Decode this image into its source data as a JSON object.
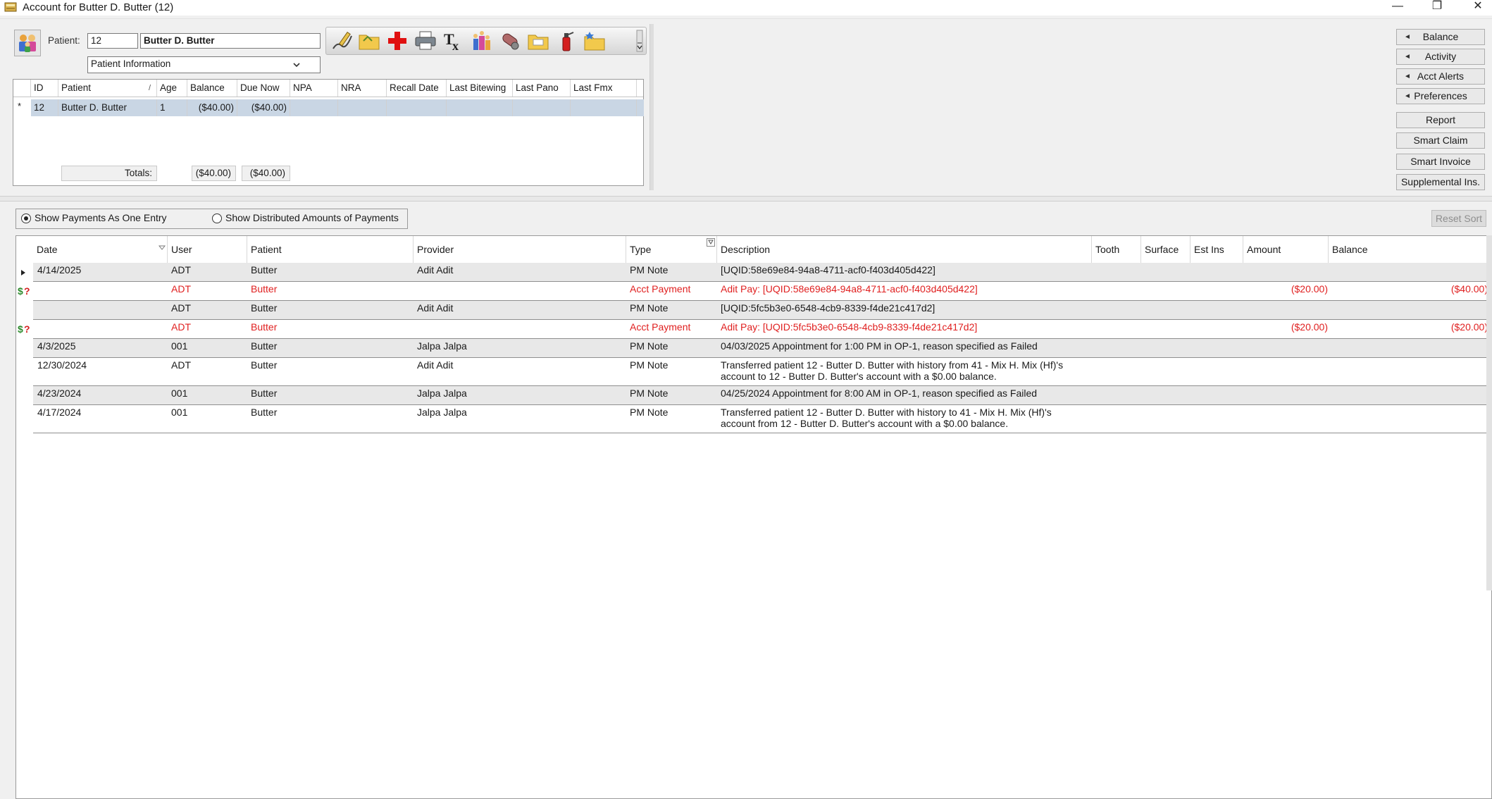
{
  "window": {
    "title": "Account for Butter D. Butter (12)",
    "minimize": "—",
    "restore": "❐",
    "close": "✕"
  },
  "patient_select": {
    "label": "Patient:",
    "id_value": "12",
    "name_value": "Butter D. Butter",
    "dropdown_value": "Patient Information"
  },
  "toolbar_icons": [
    "edit-note-icon",
    "folder-icon",
    "medical-cross-icon",
    "printer-icon",
    "prescription-icon",
    "family-icon",
    "pill-icon",
    "folder-open-icon",
    "spray-icon",
    "folder-star-icon"
  ],
  "patients_table": {
    "columns": [
      "ID",
      "Patient",
      "Age",
      "Balance",
      "Due Now",
      "NPA",
      "NRA",
      "Recall Date",
      "Last Bitewing",
      "Last Pano",
      "Last Fmx"
    ],
    "row_marker": "*",
    "rows": [
      {
        "id": "12",
        "patient": "Butter D. Butter",
        "age": "1",
        "balance": "($40.00)",
        "due_now": "($40.00)",
        "npa": "",
        "nra": "",
        "recall_date": "",
        "last_bitewing": "",
        "last_pano": "",
        "last_fmx": ""
      }
    ],
    "totals_label": "Totals:",
    "totals_balance": "($40.00)",
    "totals_due_now": "($40.00)"
  },
  "right_buttons": {
    "balance": "Balance",
    "activity": "Activity",
    "acct_alerts": "Acct Alerts",
    "preferences": "Preferences",
    "report": "Report",
    "smart_claim": "Smart Claim",
    "smart_invoice": "Smart Invoice",
    "supplemental": "Supplemental Ins."
  },
  "options": {
    "one_entry": "Show Payments As One Entry",
    "distributed": "Show Distributed Amounts of Payments",
    "selected": "one_entry",
    "reset_sort": "Reset Sort"
  },
  "ledger": {
    "columns": {
      "date": "Date",
      "user": "User",
      "patient": "Patient",
      "provider": "Provider",
      "type": "Type",
      "description": "Description",
      "tooth": "Tooth",
      "surface": "Surface",
      "est_ins": "Est Ins",
      "amount": "Amount",
      "balance": "Balance"
    },
    "rows": [
      {
        "date": "4/14/2025",
        "user": "ADT",
        "patient": "Butter",
        "provider": "Adit Adit",
        "type": "PM Note",
        "description": "[UQID:58e69e84-94a8-4711-acf0-f403d405d422]",
        "amount": "",
        "balance": "",
        "style": "note",
        "marker": "current-row-arrow"
      },
      {
        "date": "",
        "user": "ADT",
        "patient": "Butter",
        "provider": "",
        "type": "Acct Payment",
        "description": "Adit Pay: [UQID:58e69e84-94a8-4711-acf0-f403d405d422]",
        "amount": "($20.00)",
        "balance": "($40.00)",
        "style": "payment",
        "marker": "payment-unattached-icon"
      },
      {
        "date": "",
        "user": "ADT",
        "patient": "Butter",
        "provider": "Adit Adit",
        "type": "PM Note",
        "description": "[UQID:5fc5b3e0-6548-4cb9-8339-f4de21c417d2]",
        "amount": "",
        "balance": "",
        "style": "note",
        "marker": ""
      },
      {
        "date": "",
        "user": "ADT",
        "patient": "Butter",
        "provider": "",
        "type": "Acct Payment",
        "description": "Adit Pay: [UQID:5fc5b3e0-6548-4cb9-8339-f4de21c417d2]",
        "amount": "($20.00)",
        "balance": "($20.00)",
        "style": "payment",
        "marker": "payment-unattached-icon"
      },
      {
        "date": "4/3/2025",
        "user": "001",
        "patient": "Butter",
        "provider": "Jalpa Jalpa",
        "type": "PM Note",
        "description": "04/03/2025 Appointment for 1:00 PM in OP-1, reason specified as Failed",
        "amount": "",
        "balance": "",
        "style": "note",
        "marker": ""
      },
      {
        "date": "12/30/2024",
        "user": "ADT",
        "patient": "Butter",
        "provider": "Adit Adit",
        "type": "PM Note",
        "description": "Transferred patient 12 - Butter D. Butter with history from 41 - Mix H. Mix (Hf)'s account to 12 - Butter D. Butter's account with a $0.00 balance.",
        "amount": "",
        "balance": "",
        "style": "note",
        "marker": ""
      },
      {
        "date": "4/23/2024",
        "user": "001",
        "patient": "Butter",
        "provider": "Jalpa Jalpa",
        "type": "PM Note",
        "description": "04/25/2024 Appointment for 8:00 AM in OP-1, reason specified as Failed",
        "amount": "",
        "balance": "",
        "style": "note",
        "marker": ""
      },
      {
        "date": "4/17/2024",
        "user": "001",
        "patient": "Butter",
        "provider": "Jalpa Jalpa",
        "type": "PM Note",
        "description": "Transferred patient 12 - Butter D. Butter with history to 41 - Mix H. Mix (Hf)'s account from 12 - Butter D. Butter's account with a $0.00 balance.",
        "amount": "",
        "balance": "",
        "style": "note",
        "marker": ""
      }
    ]
  }
}
